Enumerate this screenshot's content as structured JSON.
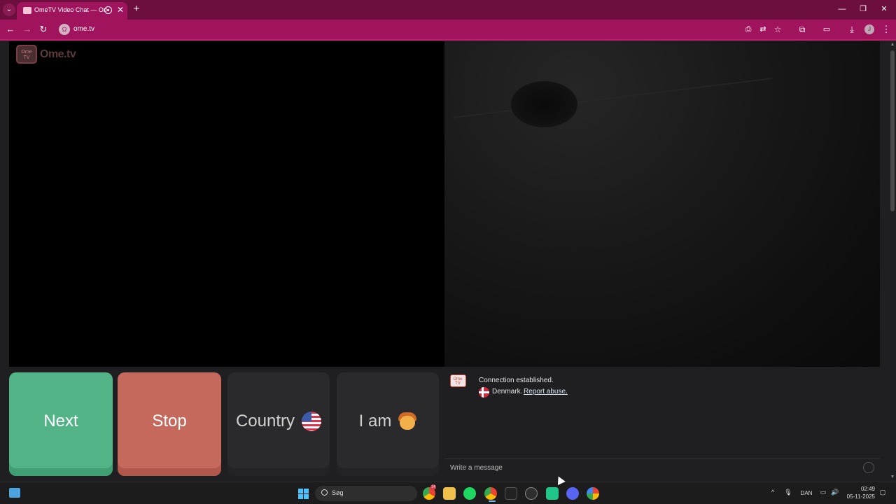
{
  "browser": {
    "tab_title": "OmeTV Video Chat — Omegle",
    "url": "ome.tv",
    "profile_initial": "J",
    "theme_color": "#a0135d"
  },
  "logo": {
    "tv_text": "Ome TV",
    "brand_text": "Ome.tv"
  },
  "controls": {
    "next_label": "Next",
    "stop_label": "Stop",
    "country_label": "Country",
    "country_flag": "us-flag-icon",
    "iam_label": "I am",
    "iam_icon": "boy-icon"
  },
  "chat": {
    "logo_text": "Ome TV",
    "connection_message": "Connection established.",
    "country": "Denmark.",
    "report_link": "Report abuse.",
    "input_placeholder": "Write a message"
  },
  "taskbar": {
    "search_label": "Søg",
    "language": "DAN",
    "time": "02:49",
    "date": "05-11-2025",
    "chrome_badge": "14"
  },
  "colors": {
    "next": "#52b486",
    "stop": "#c4695b",
    "tab_strip": "#6d0f3e"
  }
}
